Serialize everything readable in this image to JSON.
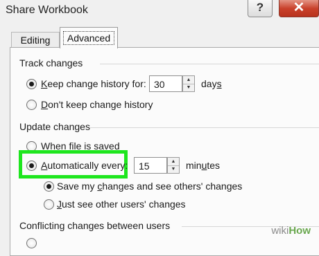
{
  "window": {
    "title": "Share Workbook",
    "help_label": "?",
    "close_label": "✕"
  },
  "tabs": {
    "editing": "Editing",
    "advanced": "Advanced"
  },
  "track_changes": {
    "heading": "Track changes",
    "keep_prefix": "K",
    "keep_rest": "eep change history for:",
    "keep_value": "30",
    "keep_unit_prefix": "day",
    "keep_unit_u": "s",
    "dont_prefix": "D",
    "dont_rest": "on't keep change history",
    "selected": "keep"
  },
  "update_changes": {
    "heading": "Update changes",
    "when_prefix": "W",
    "when_rest": "hen file is saved",
    "auto_prefix": "A",
    "auto_rest": "utomatically every:",
    "auto_value": "15",
    "auto_unit_a": "min",
    "auto_unit_u": "u",
    "auto_unit_b": "tes",
    "save_a": "Save my ",
    "save_u": "c",
    "save_b": "hanges and see others' changes",
    "just_prefix": "J",
    "just_rest": "ust see other users' changes",
    "selected": "auto",
    "sub_selected": "save"
  },
  "conflicting": {
    "heading": "Conflicting changes between users"
  },
  "watermark": {
    "part1": "wiki",
    "part2": "How"
  },
  "colors": {
    "highlight": "#1ee61e",
    "close_button": "#c9412b"
  }
}
